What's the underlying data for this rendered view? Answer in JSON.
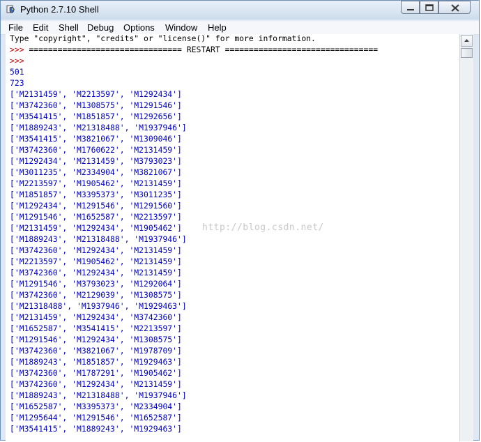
{
  "window": {
    "title": "Python 2.7.10 Shell"
  },
  "menu": [
    "File",
    "Edit",
    "Shell",
    "Debug",
    "Options",
    "Window",
    "Help"
  ],
  "shell": {
    "info_line": "Type \"copyright\", \"credits\" or \"license()\" for more information.",
    "restart_prompt": ">>> ",
    "restart_line": "================================ RESTART ================================",
    "prompt": ">>>",
    "numbers": [
      "501",
      "723"
    ],
    "output_lists": [
      "['M2131459', 'M2213597', 'M1292434']",
      "['M3742360', 'M1308575', 'M1291546']",
      "['M3541415', 'M1851857', 'M1292656']",
      "['M1889243', 'M21318488', 'M1937946']",
      "['M3541415', 'M3821067', 'M1309046']",
      "['M3742360', 'M1760622', 'M2131459']",
      "['M1292434', 'M2131459', 'M3793023']",
      "['M3011235', 'M2334904', 'M3821067']",
      "['M2213597', 'M1905462', 'M2131459']",
      "['M1851857', 'M3395373', 'M3011235']",
      "['M1292434', 'M1291546', 'M1291560']",
      "['M1291546', 'M1652587', 'M2213597']",
      "['M2131459', 'M1292434', 'M1905462']",
      "['M1889243', 'M21318488', 'M1937946']",
      "['M3742360', 'M1292434', 'M2131459']",
      "['M2213597', 'M1905462', 'M2131459']",
      "['M3742360', 'M1292434', 'M2131459']",
      "['M1291546', 'M3793023', 'M1292064']",
      "['M3742360', 'M2129039', 'M1308575']",
      "['M21318488', 'M1937946', 'M1929463']",
      "['M2131459', 'M1292434', 'M3742360']",
      "['M1652587', 'M3541415', 'M2213597']",
      "['M1291546', 'M1292434', 'M1308575']",
      "['M3742360', 'M3821067', 'M1978709']",
      "['M1889243', 'M1851857', 'M1929463']",
      "['M3742360', 'M1787291', 'M1905462']",
      "['M3742360', 'M1292434', 'M2131459']",
      "['M1889243', 'M21318488', 'M1937946']",
      "['M1652587', 'M3395373', 'M2334904']",
      "['M1295644', 'M1291546', 'M1652587']",
      "['M3541415', 'M1889243', 'M1929463']"
    ]
  },
  "watermark": "http://blog.csdn.net/",
  "colors": {
    "output": "#0000c0",
    "prompt": "#c00000",
    "titlebar": "#d9e5f3"
  }
}
